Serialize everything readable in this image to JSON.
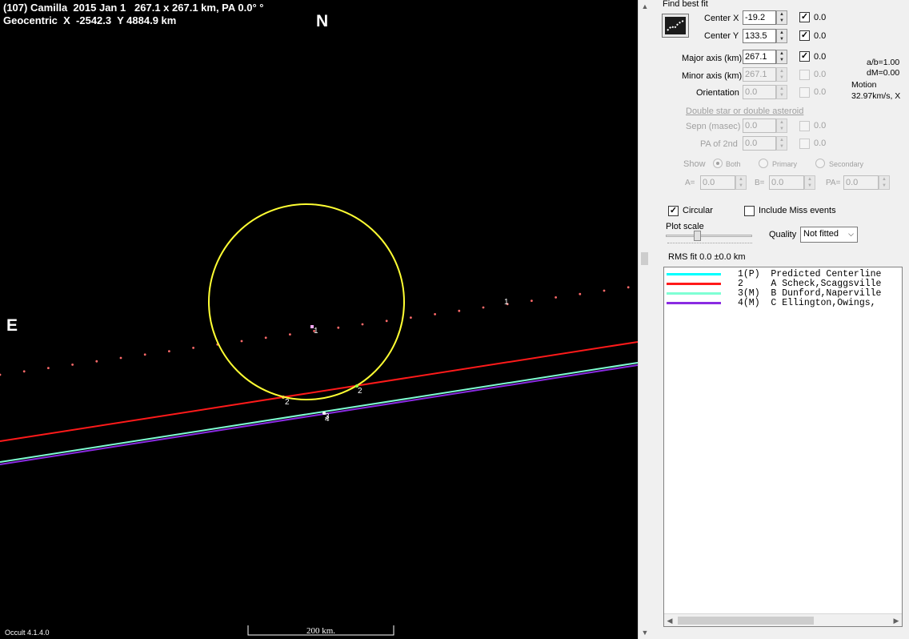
{
  "plot": {
    "header_line1": "(107) Camilla  2015 Jan 1   267.1 x 267.1 km, PA 0.0° °",
    "header_line2": "Geocentric  X  -2542.3  Y 4884.9 km",
    "north_label": "N",
    "east_label": "E",
    "version": "Occult 4.1.4.0",
    "scale_label": "200 km.",
    "chord_labels": [
      "1",
      "1",
      "2",
      "2",
      "3",
      "4"
    ],
    "colors": {
      "background": "#000000",
      "ellipse": "#ffff33",
      "predicted_path_dots": "#ff6a6a",
      "chord_1": "#00ffff",
      "chord_2": "#ff1a1a",
      "chord_3": "#7fffd4",
      "chord_4": "#8a2be2"
    }
  },
  "panel": {
    "find_best_fit_label": "Find best fit",
    "center_x_label": "Center X",
    "center_x_value": "-19.2",
    "center_x_err": "0.0",
    "center_y_label": "Center Y",
    "center_y_value": "133.5",
    "center_y_err": "0.0",
    "major_label": "Major axis (km)",
    "major_value": "267.1",
    "major_err": "0.0",
    "minor_label": "Minor axis (km)",
    "minor_value": "267.1",
    "minor_err": "0.0",
    "orientation_label": "Orientation",
    "orientation_value": "0.0",
    "orientation_err": "0.0",
    "ab_ratio": "a/b=1.00",
    "dm": "dM=0.00",
    "motion_label": "Motion",
    "motion_value": "32.97km/s, X",
    "double_star_label": "Double star  or  double asteroid",
    "sepn_label": "Sepn (masec)",
    "sepn_value": "0.0",
    "sepn_err": "0.0",
    "pa2_label": "PA of 2nd",
    "pa2_value": "0.0",
    "pa2_err": "0.0",
    "show_label": "Show",
    "show_both": "Both",
    "show_primary": "Primary",
    "show_secondary": "Secondary",
    "a_label": "A=",
    "a_value": "0.0",
    "b_label": "B=",
    "b_value": "0.0",
    "pa_label": "PA=",
    "pa_value": "0.0",
    "circular_label": "Circular",
    "circular_checked": "✓",
    "include_miss_label": "Include Miss events",
    "plot_scale_label": "Plot scale",
    "quality_label": "Quality",
    "quality_value": "Not fitted",
    "rms_label": "RMS fit 0.0 ±0.0 km",
    "check_mark": "✓"
  },
  "legend": [
    {
      "text": "1(P)  Predicted Centerline",
      "color": "#00ffff"
    },
    {
      "text": "2     A Scheck,Scaggsville",
      "color": "#ff1a1a"
    },
    {
      "text": "3(M)  B Dunford,Naperville",
      "color": "#7fffd4"
    },
    {
      "text": "4(M)  C Ellington,Owings,",
      "color": "#8a2be2"
    }
  ]
}
